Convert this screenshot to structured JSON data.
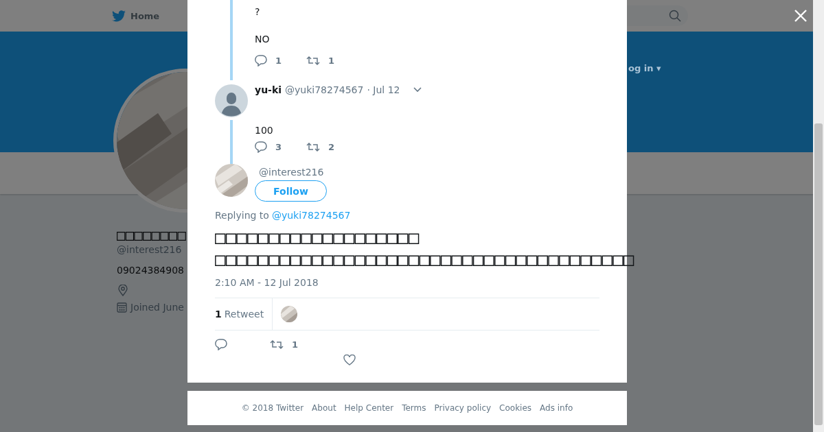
{
  "nav": {
    "home": "Home",
    "login": "og in ▾"
  },
  "profile": {
    "name": "□□□□□□□□",
    "handle": "@interest216",
    "phone": "09024384908",
    "joined": "Joined June"
  },
  "thread": [
    {
      "kind": "tail",
      "lines": [
        "?",
        "NO"
      ],
      "replies": "1",
      "retweets": "1"
    },
    {
      "kind": "tweet",
      "name": "yu-ki",
      "handle": "@yuki78274567",
      "date": "· Jul 12",
      "lines": [
        "100"
      ],
      "replies": "3",
      "retweets": "2"
    }
  ],
  "main_tweet": {
    "handle": "@interest216",
    "follow": "Follow",
    "replying_label": "Replying to",
    "replying_to": "@yuki78274567",
    "text": "□□□□□□□□□□□□□□□□□□□\n□□□□□□□□□□□□□□□□□□□□□□□□□□□□□□□□□□□□□□□",
    "time": "2:10 AM - 12 Jul 2018",
    "retweet_summary": "**1** Retweet",
    "retweets": "1"
  },
  "footer": [
    "© 2018 Twitter",
    "About",
    "Help Center",
    "Terms",
    "Privacy policy",
    "Cookies",
    "Ads info"
  ]
}
